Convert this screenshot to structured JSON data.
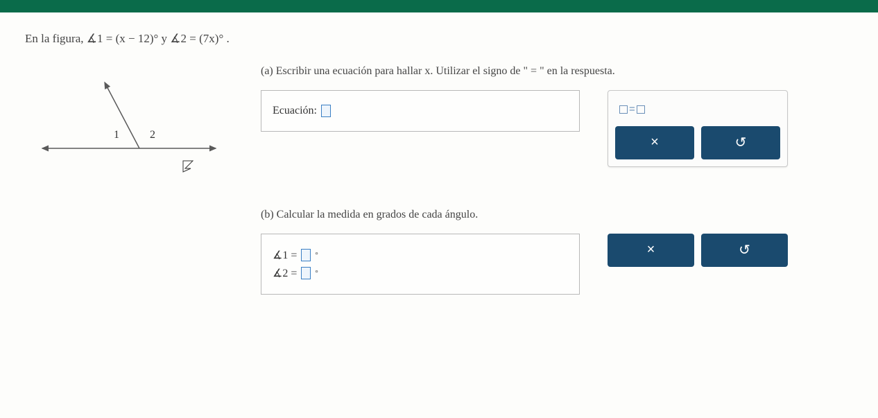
{
  "problem": {
    "intro_prefix": "En la figura, ",
    "angle1_expr": "∡1 = (x − 12)°",
    "conj": " y ",
    "angle2_expr": "∡2 = (7x)°",
    "suffix": "."
  },
  "figure": {
    "label1": "1",
    "label2": "2"
  },
  "partA": {
    "label": "(a)",
    "prompt": "Escribir una ecuación para hallar x. Utilizar el signo de \" = \" en la respuesta.",
    "equation_label": "Ecuación:",
    "tool_equals": "=",
    "btn_clear": "×",
    "btn_reset": "↺"
  },
  "partB": {
    "label": "(b)",
    "prompt": "Calcular la medida en grados de cada ángulo.",
    "angle1_label": "∡1 =",
    "angle2_label": "∡2 =",
    "degree": "°",
    "btn_clear": "×",
    "btn_reset": "↺"
  }
}
